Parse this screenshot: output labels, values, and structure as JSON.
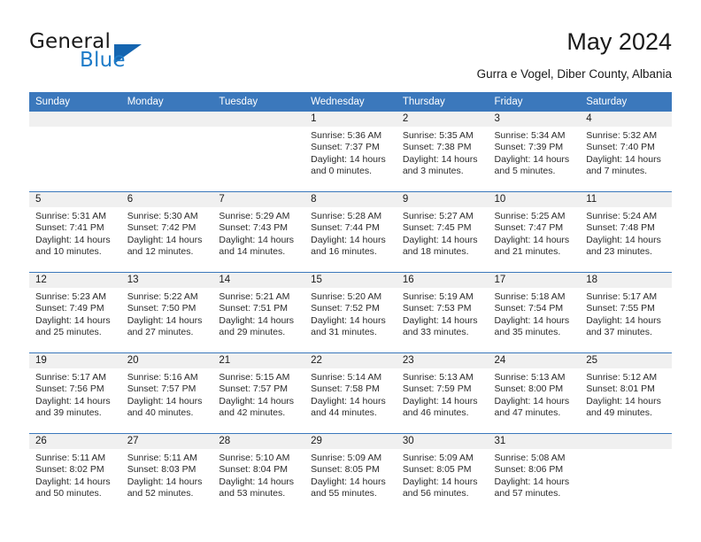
{
  "brand": {
    "name_part1": "General",
    "name_part2": "Blue",
    "triangle_color": "#1565b0",
    "blue_color": "#1e7bc8"
  },
  "header": {
    "month_title": "May 2024",
    "location": "Gurra e Vogel, Diber County, Albania"
  },
  "theme": {
    "header_bg": "#3b78bc",
    "daynum_bg": "#f0f0f0",
    "separator": "#3b78bc",
    "text": "#1a1a1a"
  },
  "weekday_headers": [
    "Sunday",
    "Monday",
    "Tuesday",
    "Wednesday",
    "Thursday",
    "Friday",
    "Saturday"
  ],
  "weeks": [
    [
      {
        "day": "",
        "sunrise": "",
        "sunset": "",
        "daylight_line1": "",
        "daylight_line2": "",
        "empty": true
      },
      {
        "day": "",
        "sunrise": "",
        "sunset": "",
        "daylight_line1": "",
        "daylight_line2": "",
        "empty": true
      },
      {
        "day": "",
        "sunrise": "",
        "sunset": "",
        "daylight_line1": "",
        "daylight_line2": "",
        "empty": true
      },
      {
        "day": "1",
        "sunrise": "Sunrise: 5:36 AM",
        "sunset": "Sunset: 7:37 PM",
        "daylight_line1": "Daylight: 14 hours",
        "daylight_line2": "and 0 minutes."
      },
      {
        "day": "2",
        "sunrise": "Sunrise: 5:35 AM",
        "sunset": "Sunset: 7:38 PM",
        "daylight_line1": "Daylight: 14 hours",
        "daylight_line2": "and 3 minutes."
      },
      {
        "day": "3",
        "sunrise": "Sunrise: 5:34 AM",
        "sunset": "Sunset: 7:39 PM",
        "daylight_line1": "Daylight: 14 hours",
        "daylight_line2": "and 5 minutes."
      },
      {
        "day": "4",
        "sunrise": "Sunrise: 5:32 AM",
        "sunset": "Sunset: 7:40 PM",
        "daylight_line1": "Daylight: 14 hours",
        "daylight_line2": "and 7 minutes."
      }
    ],
    [
      {
        "day": "5",
        "sunrise": "Sunrise: 5:31 AM",
        "sunset": "Sunset: 7:41 PM",
        "daylight_line1": "Daylight: 14 hours",
        "daylight_line2": "and 10 minutes."
      },
      {
        "day": "6",
        "sunrise": "Sunrise: 5:30 AM",
        "sunset": "Sunset: 7:42 PM",
        "daylight_line1": "Daylight: 14 hours",
        "daylight_line2": "and 12 minutes."
      },
      {
        "day": "7",
        "sunrise": "Sunrise: 5:29 AM",
        "sunset": "Sunset: 7:43 PM",
        "daylight_line1": "Daylight: 14 hours",
        "daylight_line2": "and 14 minutes."
      },
      {
        "day": "8",
        "sunrise": "Sunrise: 5:28 AM",
        "sunset": "Sunset: 7:44 PM",
        "daylight_line1": "Daylight: 14 hours",
        "daylight_line2": "and 16 minutes."
      },
      {
        "day": "9",
        "sunrise": "Sunrise: 5:27 AM",
        "sunset": "Sunset: 7:45 PM",
        "daylight_line1": "Daylight: 14 hours",
        "daylight_line2": "and 18 minutes."
      },
      {
        "day": "10",
        "sunrise": "Sunrise: 5:25 AM",
        "sunset": "Sunset: 7:47 PM",
        "daylight_line1": "Daylight: 14 hours",
        "daylight_line2": "and 21 minutes."
      },
      {
        "day": "11",
        "sunrise": "Sunrise: 5:24 AM",
        "sunset": "Sunset: 7:48 PM",
        "daylight_line1": "Daylight: 14 hours",
        "daylight_line2": "and 23 minutes."
      }
    ],
    [
      {
        "day": "12",
        "sunrise": "Sunrise: 5:23 AM",
        "sunset": "Sunset: 7:49 PM",
        "daylight_line1": "Daylight: 14 hours",
        "daylight_line2": "and 25 minutes."
      },
      {
        "day": "13",
        "sunrise": "Sunrise: 5:22 AM",
        "sunset": "Sunset: 7:50 PM",
        "daylight_line1": "Daylight: 14 hours",
        "daylight_line2": "and 27 minutes."
      },
      {
        "day": "14",
        "sunrise": "Sunrise: 5:21 AM",
        "sunset": "Sunset: 7:51 PM",
        "daylight_line1": "Daylight: 14 hours",
        "daylight_line2": "and 29 minutes."
      },
      {
        "day": "15",
        "sunrise": "Sunrise: 5:20 AM",
        "sunset": "Sunset: 7:52 PM",
        "daylight_line1": "Daylight: 14 hours",
        "daylight_line2": "and 31 minutes."
      },
      {
        "day": "16",
        "sunrise": "Sunrise: 5:19 AM",
        "sunset": "Sunset: 7:53 PM",
        "daylight_line1": "Daylight: 14 hours",
        "daylight_line2": "and 33 minutes."
      },
      {
        "day": "17",
        "sunrise": "Sunrise: 5:18 AM",
        "sunset": "Sunset: 7:54 PM",
        "daylight_line1": "Daylight: 14 hours",
        "daylight_line2": "and 35 minutes."
      },
      {
        "day": "18",
        "sunrise": "Sunrise: 5:17 AM",
        "sunset": "Sunset: 7:55 PM",
        "daylight_line1": "Daylight: 14 hours",
        "daylight_line2": "and 37 minutes."
      }
    ],
    [
      {
        "day": "19",
        "sunrise": "Sunrise: 5:17 AM",
        "sunset": "Sunset: 7:56 PM",
        "daylight_line1": "Daylight: 14 hours",
        "daylight_line2": "and 39 minutes."
      },
      {
        "day": "20",
        "sunrise": "Sunrise: 5:16 AM",
        "sunset": "Sunset: 7:57 PM",
        "daylight_line1": "Daylight: 14 hours",
        "daylight_line2": "and 40 minutes."
      },
      {
        "day": "21",
        "sunrise": "Sunrise: 5:15 AM",
        "sunset": "Sunset: 7:57 PM",
        "daylight_line1": "Daylight: 14 hours",
        "daylight_line2": "and 42 minutes."
      },
      {
        "day": "22",
        "sunrise": "Sunrise: 5:14 AM",
        "sunset": "Sunset: 7:58 PM",
        "daylight_line1": "Daylight: 14 hours",
        "daylight_line2": "and 44 minutes."
      },
      {
        "day": "23",
        "sunrise": "Sunrise: 5:13 AM",
        "sunset": "Sunset: 7:59 PM",
        "daylight_line1": "Daylight: 14 hours",
        "daylight_line2": "and 46 minutes."
      },
      {
        "day": "24",
        "sunrise": "Sunrise: 5:13 AM",
        "sunset": "Sunset: 8:00 PM",
        "daylight_line1": "Daylight: 14 hours",
        "daylight_line2": "and 47 minutes."
      },
      {
        "day": "25",
        "sunrise": "Sunrise: 5:12 AM",
        "sunset": "Sunset: 8:01 PM",
        "daylight_line1": "Daylight: 14 hours",
        "daylight_line2": "and 49 minutes."
      }
    ],
    [
      {
        "day": "26",
        "sunrise": "Sunrise: 5:11 AM",
        "sunset": "Sunset: 8:02 PM",
        "daylight_line1": "Daylight: 14 hours",
        "daylight_line2": "and 50 minutes."
      },
      {
        "day": "27",
        "sunrise": "Sunrise: 5:11 AM",
        "sunset": "Sunset: 8:03 PM",
        "daylight_line1": "Daylight: 14 hours",
        "daylight_line2": "and 52 minutes."
      },
      {
        "day": "28",
        "sunrise": "Sunrise: 5:10 AM",
        "sunset": "Sunset: 8:04 PM",
        "daylight_line1": "Daylight: 14 hours",
        "daylight_line2": "and 53 minutes."
      },
      {
        "day": "29",
        "sunrise": "Sunrise: 5:09 AM",
        "sunset": "Sunset: 8:05 PM",
        "daylight_line1": "Daylight: 14 hours",
        "daylight_line2": "and 55 minutes."
      },
      {
        "day": "30",
        "sunrise": "Sunrise: 5:09 AM",
        "sunset": "Sunset: 8:05 PM",
        "daylight_line1": "Daylight: 14 hours",
        "daylight_line2": "and 56 minutes."
      },
      {
        "day": "31",
        "sunrise": "Sunrise: 5:08 AM",
        "sunset": "Sunset: 8:06 PM",
        "daylight_line1": "Daylight: 14 hours",
        "daylight_line2": "and 57 minutes."
      },
      {
        "day": "",
        "sunrise": "",
        "sunset": "",
        "daylight_line1": "",
        "daylight_line2": "",
        "empty": true
      }
    ]
  ]
}
